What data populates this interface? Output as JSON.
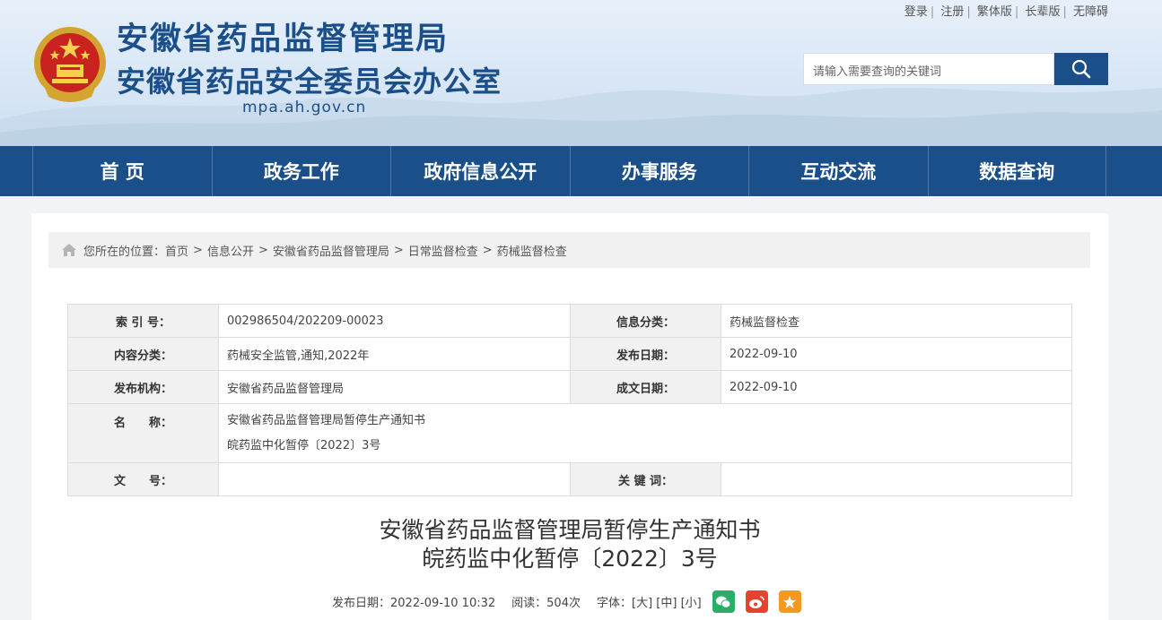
{
  "header": {
    "title": "安徽省药品监督管理局",
    "subtitle": "安徽省药品安全委员会办公室",
    "domain": "mpa.ah.gov.cn",
    "toplinks": [
      "登录",
      "注册",
      "繁体版",
      "长辈版",
      "无障碍"
    ],
    "search_placeholder": "请输入需要查询的关键词"
  },
  "nav": [
    "首 页",
    "政务工作",
    "政府信息公开",
    "办事服务",
    "互动交流",
    "数据查询"
  ],
  "breadcrumb": {
    "prefix": "您所在的位置：",
    "items": [
      "首页",
      "信息公开",
      "安徽省药品监督管理局",
      "日常监督检查",
      "药械监督检查"
    ],
    "sep": ">"
  },
  "meta": {
    "index_label": "索 引 号：",
    "index_value": "002986504/202209-00023",
    "category_label": "信息分类：",
    "category_value": "药械监督检查",
    "content_label": "内容分类：",
    "content_value": "药械安全监管,通知,2022年",
    "pubdate_label": "发布日期：",
    "pubdate_value": "2022-09-10",
    "org_label": "发布机构：",
    "org_value": "安徽省药品监督管理局",
    "docdate_label": "成文日期：",
    "docdate_value": "2022-09-10",
    "name_label": "名　　称：",
    "name_line1": "安徽省药品监督管理局暂停生产通知书",
    "name_line2": "皖药监中化暂停〔2022〕3号",
    "docno_label": "文　　号：",
    "docno_value": "",
    "keyword_label": "关 键 词：",
    "keyword_value": ""
  },
  "article": {
    "title_line1": "安徽省药品监督管理局暂停生产通知书",
    "title_line2": "皖药监中化暂停〔2022〕3号",
    "pubdate": "发布日期：2022-09-10 10:32",
    "reads": "阅读：504次",
    "font_label": "字体：",
    "font_large": "[大]",
    "font_medium": "[中]",
    "font_small": "[小]"
  },
  "colors": {
    "primary": "#1b4f8a",
    "wechat": "#2aae67",
    "weibo": "#e6432e",
    "favorite": "#f39a1e"
  }
}
